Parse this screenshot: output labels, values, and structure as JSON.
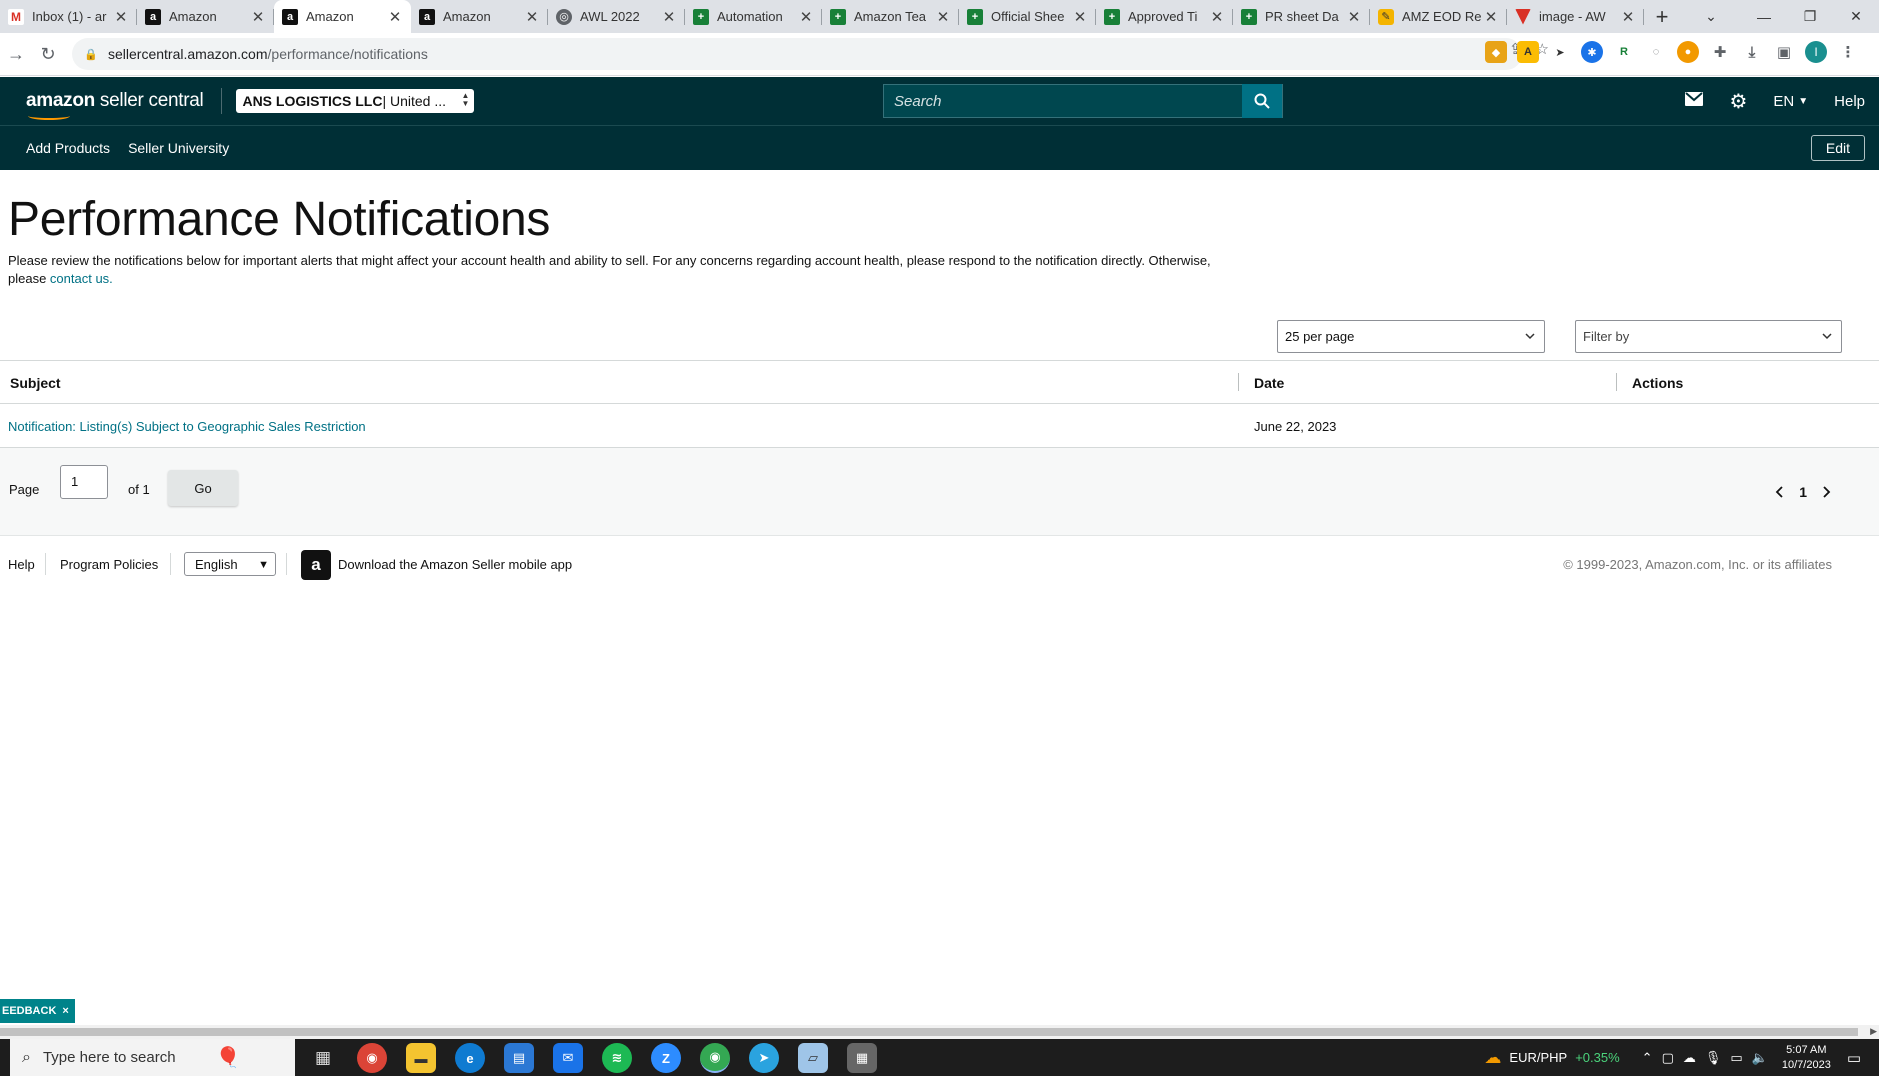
{
  "browser": {
    "tabs": [
      {
        "title": "Inbox (1) - ar",
        "icon": "gmail-icon",
        "active": false
      },
      {
        "title": "Amazon",
        "icon": "amazon-icon",
        "active": false
      },
      {
        "title": "Amazon",
        "icon": "amazon-icon",
        "active": true
      },
      {
        "title": "Amazon",
        "icon": "amazon-icon",
        "active": false
      },
      {
        "title": "AWL 2022",
        "icon": "globe-icon",
        "active": false
      },
      {
        "title": "Automation",
        "icon": "sheets-icon",
        "active": false
      },
      {
        "title": "Amazon Tea",
        "icon": "sheets-icon",
        "active": false
      },
      {
        "title": "Official Shee",
        "icon": "sheets-icon",
        "active": false
      },
      {
        "title": "Approved Ti",
        "icon": "sheets-icon",
        "active": false
      },
      {
        "title": "PR sheet Da",
        "icon": "sheets-icon",
        "active": false
      },
      {
        "title": "AMZ EOD Re",
        "icon": "zapier-icon",
        "active": false
      },
      {
        "title": "image - AW",
        "icon": "image-icon",
        "active": false
      }
    ],
    "new_tab": "+",
    "url_host": "sellercentral.amazon.com",
    "url_path": "/performance/notifications",
    "profile_initial": "I"
  },
  "header": {
    "logo_bold": "amazon",
    "logo_rest": " seller central",
    "account_bold": "ANS LOGISTICS LLC",
    "account_rest": " | United ...",
    "search_placeholder": "Search",
    "language": "EN",
    "help": "Help"
  },
  "subnav": {
    "items": [
      "Add Products",
      "Seller University"
    ],
    "edit": "Edit"
  },
  "page": {
    "title": "Performance Notifications",
    "description": "Please review the notifications below for important alerts that might affect your account health and ability to sell. For any concerns regarding account health, please respond to the notification directly. Otherwise, please ",
    "contact_link": "contact us.",
    "per_page": "25 per page",
    "filter_placeholder": "Filter by"
  },
  "table": {
    "headers": {
      "subject": "Subject",
      "date": "Date",
      "actions": "Actions"
    },
    "rows": [
      {
        "subject": "Notification: Listing(s) Subject to Geographic Sales Restriction",
        "date": "June 22, 2023",
        "actions": ""
      }
    ]
  },
  "pagination": {
    "page_label": "Page",
    "current": "1",
    "of_label": "of 1",
    "go": "Go",
    "nav_page": "1"
  },
  "footer": {
    "help": "Help",
    "policies": "Program Policies",
    "language": "English",
    "app": "Download the Amazon Seller mobile app",
    "copyright": "© 1999-2023, Amazon.com, Inc. or its affiliates"
  },
  "feedback": {
    "label": "EEDBACK",
    "close": "×"
  },
  "taskbar": {
    "search_placeholder": "Type here to search",
    "currency": "EUR/PHP",
    "change": "+0.35%",
    "time": "5:07 AM",
    "date": "10/7/2023"
  }
}
